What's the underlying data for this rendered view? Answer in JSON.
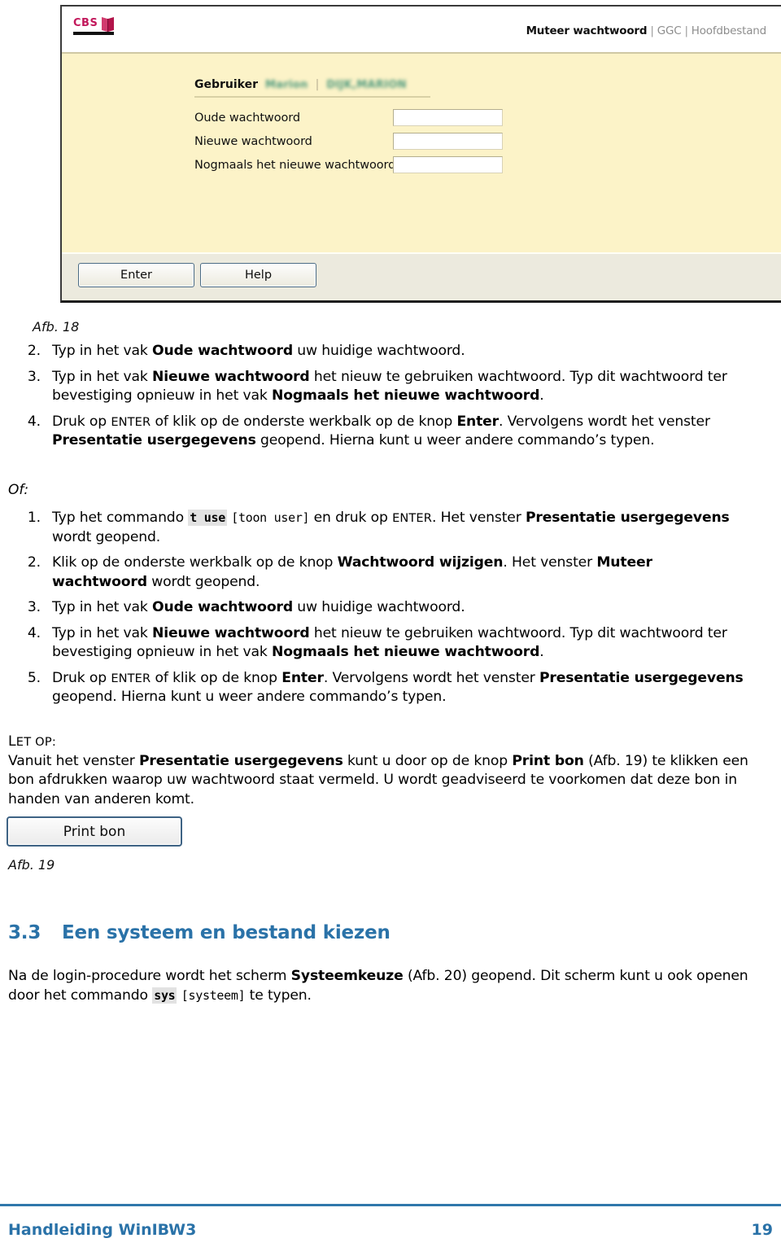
{
  "figure18": {
    "logo_text": "CBS",
    "nav": {
      "current": "Muteer wachtwoord",
      "separator": "|",
      "link1": "GGC",
      "link2": "Hoofdbestand"
    },
    "form": {
      "user_label": "Gebruiker",
      "user_name_redacted": "Marion",
      "user_divider": "|",
      "user_full_redacted": "DIJK,MARION",
      "fields": [
        {
          "label": "Oude wachtwoord",
          "value": ""
        },
        {
          "label": "Nieuwe wachtwoord",
          "value": ""
        },
        {
          "label": "Nogmaals het nieuwe wachtwoord",
          "value": ""
        }
      ]
    },
    "toolbar": {
      "enter_label": "Enter",
      "help_label": "Help"
    },
    "caption": "Afb. 18",
    "colors": {
      "panel_background": "#fcf3c8",
      "toolbar_background": "#eceade",
      "logo_accent": "#c2185b",
      "redacted_text": "#4f9a7e"
    }
  },
  "list_a": [
    {
      "num": "2.",
      "html": "Typ in het vak <b>Oude wachtwoord</b> uw huidige wachtwoord."
    },
    {
      "num": "3.",
      "html": "Typ in het vak <b>Nieuwe wachtwoord</b> het nieuw te gebruiken wachtwoord. Typ dit wachtwoord ter bevestiging opnieuw in het vak <b>Nogmaals het nieuwe wachtwoord</b>."
    },
    {
      "num": "4.",
      "html": "Druk op <span class=\"sc\">ENTER</span> of klik op de onderste werkbalk op de knop <b>Enter</b>. Vervolgens wordt het venster <b>Presentatie usergegevens</b> geopend. Hierna kunt u weer andere commando’s typen."
    }
  ],
  "of_label": "Of:",
  "list_b": [
    {
      "num": "1.",
      "html": "Typ het commando <span class=\"mono-hl\">t use</span> <span class=\"mono\">[toon user]</span> en druk op <span class=\"sc\">ENTER</span>. Het venster <b>Presentatie usergegevens</b> wordt geopend."
    },
    {
      "num": "2.",
      "html": "Klik op de onderste werkbalk op de knop <b>Wachtwoord wijzigen</b>. Het venster <b>Muteer wachtwoord</b> wordt geopend."
    },
    {
      "num": "3.",
      "html": "Typ in het vak <b>Oude wachtwoord</b> uw huidige wachtwoord."
    },
    {
      "num": "4.",
      "html": "Typ in het vak <b>Nieuwe wachtwoord</b> het nieuw te gebruiken wachtwoord. Typ dit wachtwoord ter bevestiging opnieuw in het vak <b>Nogmaals het nieuwe wachtwoord</b>."
    },
    {
      "num": "5.",
      "html": "Druk op <span class=\"sc\">ENTER</span> of klik op de knop <b>Enter</b>. Vervolgens wordt het venster <b>Presentatie usergegevens</b> geopend. Hierna kunt u weer andere commando’s typen."
    }
  ],
  "note": {
    "heading": "LET OP:",
    "heading_sc": "ET OP:",
    "heading_first": "L",
    "html": "Vanuit het venster <b>Presentatie usergegevens</b> kunt u door op de knop <b>Print bon</b> (Afb. 19) te klikken een bon afdrukken waarop uw wachtwoord staat vermeld. U wordt geadviseerd te voorkomen dat deze bon in handen van anderen komt."
  },
  "figure19": {
    "button_label": "Print bon",
    "caption": "Afb. 19"
  },
  "section": {
    "number": "3.3",
    "title": "Een systeem en bestand kiezen",
    "body_html": "Na de login-procedure wordt het scherm <b>Systeemkeuze</b> (Afb. 20) geopend. Dit scherm kunt u ook openen door het commando <span class=\"mono-hl\">sys</span> <span class=\"mono\">[systeem]</span> te typen.",
    "heading_color": "#2a72a8"
  },
  "footer": {
    "title": "Handleiding WinIBW3",
    "page": "19",
    "rule_color": "#2f77ab"
  }
}
